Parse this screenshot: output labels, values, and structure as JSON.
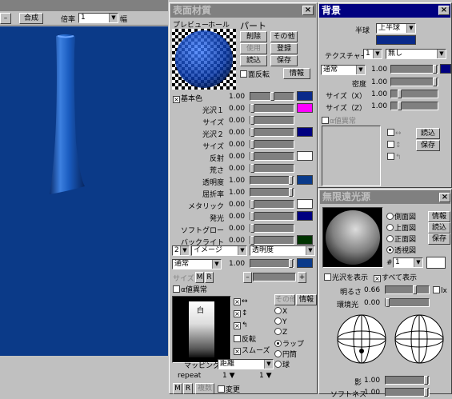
{
  "viewport": {
    "merge_label": "合成",
    "zoom_label": "倍率",
    "zoom_value": "1",
    "width_label": "幅"
  },
  "material": {
    "title": "表面材質",
    "tabs": [
      "プレビュー",
      "ホール"
    ],
    "part_label": "パート",
    "buttons": [
      "削除",
      "その他",
      "使用",
      "登録",
      "読込",
      "保存"
    ],
    "flip_label": "面反転",
    "info_label": "情報",
    "base_color_label": "基本色",
    "base_color_value": "1.00",
    "base_color": "#0a2a8a",
    "props": [
      {
        "label": "光沢１",
        "value": "0.00",
        "color": "#ff00ff"
      },
      {
        "label": "サイズ",
        "value": "0.00",
        "color": ""
      },
      {
        "label": "光沢２",
        "value": "0.00",
        "color": "#000080"
      },
      {
        "label": "サイズ",
        "value": "0.00",
        "color": ""
      },
      {
        "label": "反射",
        "value": "0.00",
        "color": "#ffffff"
      },
      {
        "label": "荒さ",
        "value": "0.00",
        "color": ""
      },
      {
        "label": "透明度",
        "value": "1.00",
        "color": "#0a3a8a"
      },
      {
        "label": "屈折率",
        "value": "1.00",
        "color": ""
      },
      {
        "label": "メタリック",
        "value": "0.00",
        "color": "#ffffff"
      },
      {
        "label": "発光",
        "value": "0.00",
        "color": "#000080"
      },
      {
        "label": "ソフトグロー",
        "value": "0.00",
        "color": ""
      },
      {
        "label": "バックライト",
        "value": "0.00",
        "color": "#003300"
      }
    ],
    "layer_num": "2",
    "layer_type": "イメージ",
    "layer_target": "透明度",
    "blend_mode": "通常",
    "blend_value": "1.00",
    "blend_color": "#0a3a8a",
    "size_label": "サイズ",
    "m_label": "M",
    "r_label": "R",
    "alpha_label": "α値異常",
    "preview_text": "白",
    "map_opts": [
      "反転",
      "スムーズ"
    ],
    "other_label": "その他",
    "info2_label": "情報",
    "axis": [
      "X",
      "Y",
      "Z",
      "ラップ",
      "円筒",
      "球"
    ],
    "mapping_label": "マッピング",
    "mapping_value": "距離",
    "repeat_label": "repeat",
    "repeat_x": "1",
    "repeat_y": "1",
    "bottom": [
      "M",
      "R",
      "複数",
      "変更"
    ]
  },
  "background": {
    "title": "背景",
    "hemisphere_label": "半球",
    "hemisphere_value": "上半球",
    "hemi_color": "#0a2a8a",
    "texture_label": "テクスチャー",
    "texture_num": "1",
    "texture_value": "無し",
    "blend_mode": "通常",
    "blend_value": "1.00",
    "rows": [
      {
        "label": "密度",
        "value": "1.00"
      },
      {
        "label": "サイズ（X）",
        "value": "1.00"
      },
      {
        "label": "サイズ（Z）",
        "value": "1.00"
      }
    ],
    "alpha_label": "α値異常",
    "load_label": "読込",
    "save_label": "保存"
  },
  "light": {
    "title": "無限遠光源",
    "views": [
      "側面図",
      "上面図",
      "正面図",
      "透視図"
    ],
    "info_label": "情報",
    "load_label": "読込",
    "save_label": "保存",
    "num": "1",
    "show_gloss": "光沢を表示",
    "show_all": "すべて表示",
    "brightness_label": "明るさ",
    "brightness_value": "0.66",
    "lx_label": "lx",
    "ambient_label": "環境光",
    "ambient_value": "0.00",
    "shadow_label": "影",
    "shadow_value": "1.00",
    "soft_label": "ソフトネス",
    "soft_value": "1.00"
  }
}
